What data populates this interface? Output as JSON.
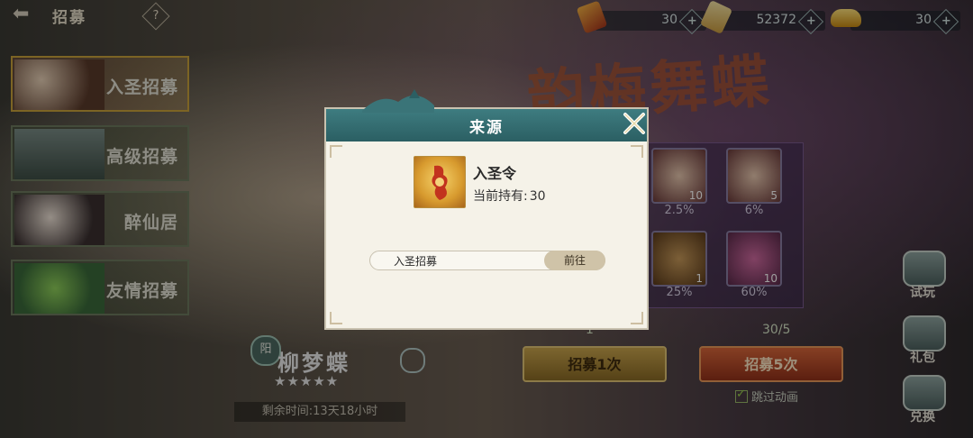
{
  "topbar": {
    "title": "招募",
    "help_glyph": "?",
    "resources": [
      {
        "icon": "recruit-token-icon",
        "value": "30",
        "plus": "+"
      },
      {
        "icon": "scroll-icon",
        "value": "52372",
        "plus": "+"
      },
      {
        "icon": "gold-ingot-icon",
        "value": "30",
        "plus": "+"
      }
    ]
  },
  "menu": [
    {
      "label": "入圣招募",
      "active": true
    },
    {
      "label": "高级招募",
      "active": false
    },
    {
      "label": "醉仙居",
      "active": false
    },
    {
      "label": "友情招募",
      "active": false
    }
  ],
  "banner": {
    "title": "韵梅舞蝶"
  },
  "rewards": [
    {
      "count": "10",
      "pct": "2.5%"
    },
    {
      "count": "5",
      "pct": "6%"
    },
    {
      "count": "1",
      "pct": "25%"
    },
    {
      "count": "10",
      "pct": "60%"
    }
  ],
  "hero": {
    "name": "柳梦蝶",
    "faction": "阳",
    "stars": "★★★★★",
    "time_left": "剩余时间:13天18小时"
  },
  "cost": {
    "once": "1",
    "five": "30/5"
  },
  "buttons": {
    "once": "招募1次",
    "five": "招募5次"
  },
  "skip_label": "跳过动画",
  "side": [
    {
      "label": "试玩",
      "icon": "trial-icon"
    },
    {
      "label": "礼包",
      "icon": "gift-icon"
    },
    {
      "label": "兑换",
      "icon": "exchange-icon"
    }
  ],
  "modal": {
    "title": "来源",
    "close": "✕",
    "item_name": "入圣令",
    "hold_label": "当前持有:",
    "hold_value": "30",
    "source_label": "入圣招募",
    "go_label": "前往"
  },
  "colors": {
    "header_teal": "#2b5f63",
    "modal_bg": "#f5f2e8",
    "go_btn": "#cfc3a8"
  }
}
